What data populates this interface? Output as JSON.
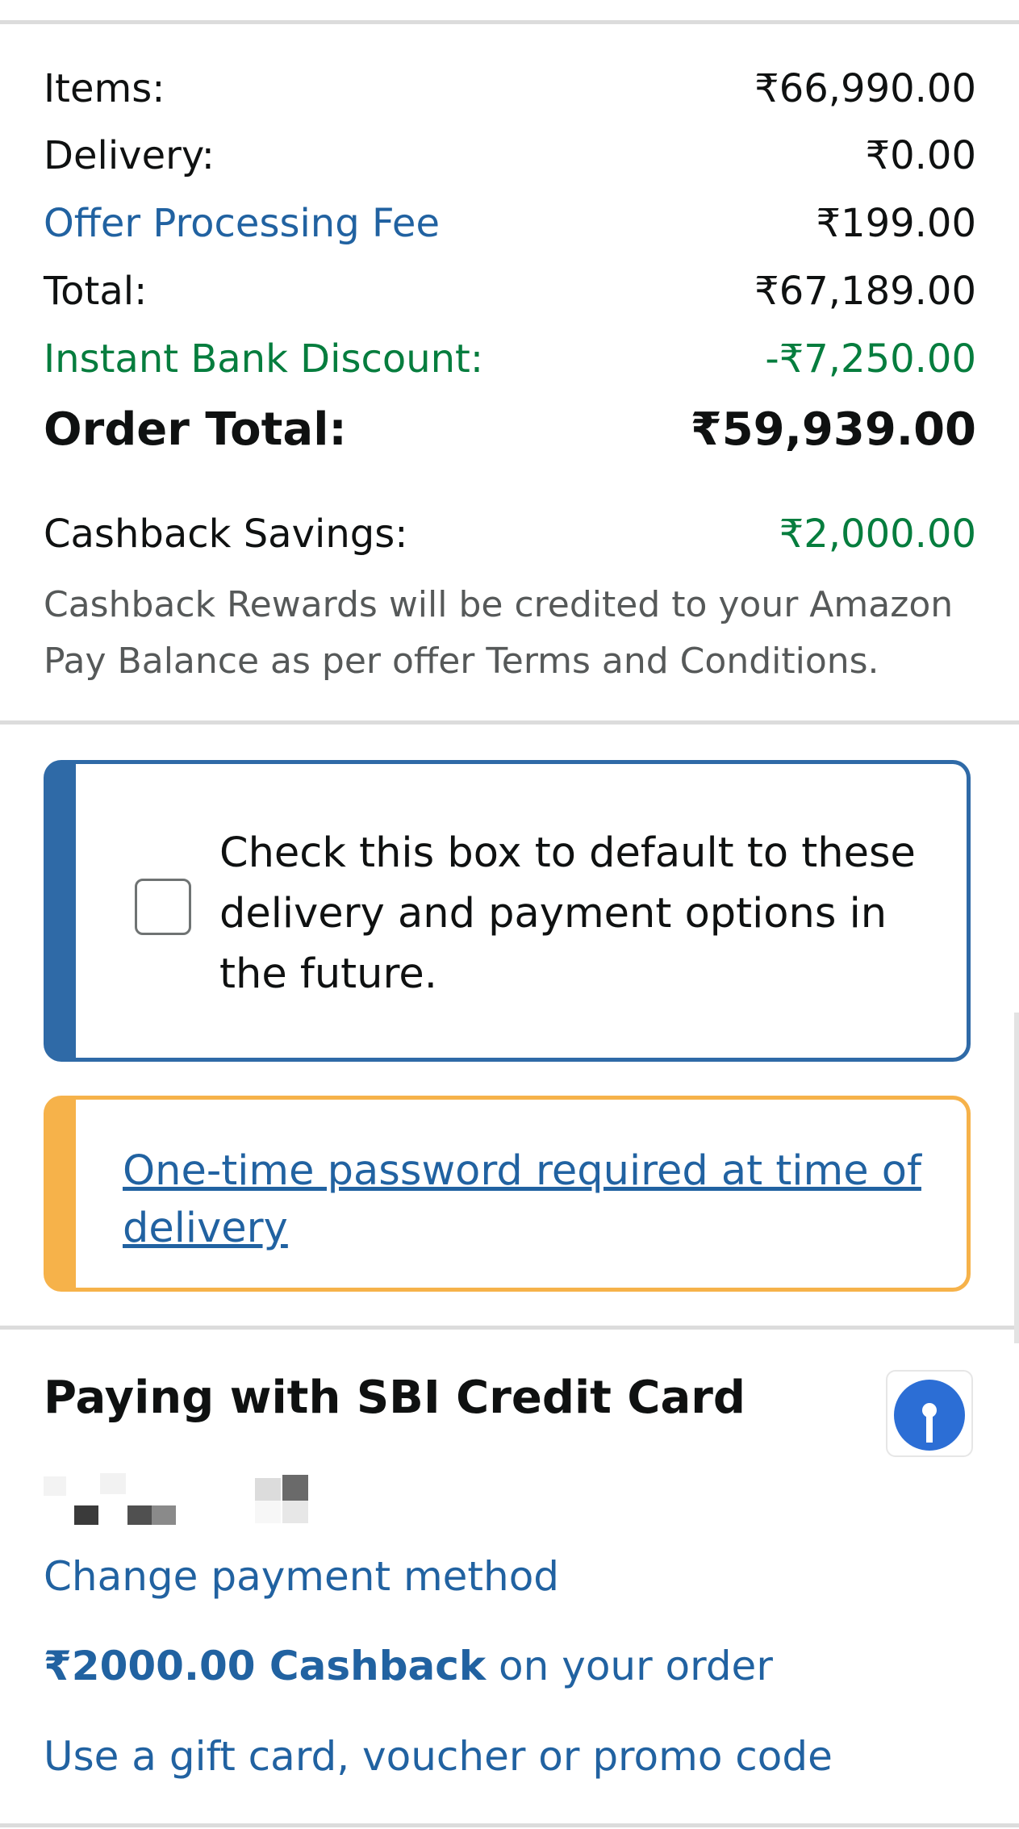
{
  "summary": {
    "items_label": "Items:",
    "items_value": "₹66,990.00",
    "delivery_label": "Delivery:",
    "delivery_value": "₹0.00",
    "fee_label": "Offer Processing Fee",
    "fee_value": "₹199.00",
    "total_label": "Total:",
    "total_value": "₹67,189.00",
    "discount_label": "Instant Bank Discount:",
    "discount_value": "-₹7,250.00",
    "order_total_label": "Order Total:",
    "order_total_value": "₹59,939.00",
    "cashback_label": "Cashback Savings:",
    "cashback_value": "₹2,000.00",
    "cashback_note": "Cashback Rewards will be credited to your Amazon Pay Balance as per offer Terms and Conditions."
  },
  "default_option": {
    "checked": false,
    "text": "Check this box to default to these delivery and payment options in the future."
  },
  "otp_notice": {
    "link_text": "One-time password required at time of delivery"
  },
  "payment": {
    "title": "Paying with SBI Credit Card",
    "bank_icon": "sbi-logo-icon",
    "change_link": "Change payment method",
    "cashback_amount": "₹2000.00 Cashback",
    "cashback_suffix": " on your order",
    "gift_card_link": "Use a gift card, voucher or promo code"
  },
  "colors": {
    "link_blue": "#2162a1",
    "discount_green": "#067d3e",
    "info_blue_border": "#2f6aa7",
    "alert_amber_border": "#f6b24a"
  }
}
